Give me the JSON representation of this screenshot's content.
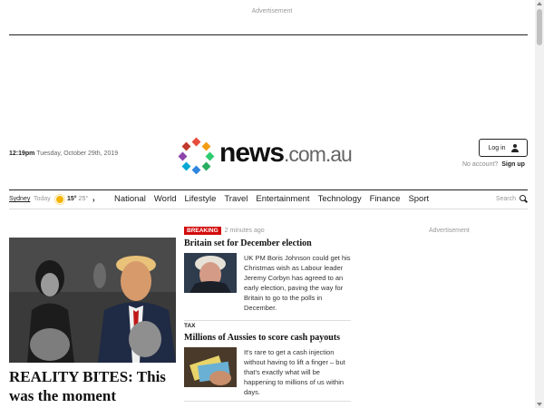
{
  "ads": {
    "top_label": "Advertisement",
    "right_label": "Advertisement"
  },
  "header": {
    "time": "12:19pm",
    "date": "Tuesday, October 29th, 2019",
    "logo_main": "news",
    "logo_domain": ".com.au",
    "login_label": "Log in",
    "no_account_text": "No account?",
    "signup_label": "Sign up"
  },
  "weather": {
    "location": "Sydney",
    "day": "Today",
    "high": "15°",
    "low": "25°",
    "icon": "sun-icon"
  },
  "nav": {
    "items": [
      "National",
      "World",
      "Lifestyle",
      "Travel",
      "Entertainment",
      "Technology",
      "Finance",
      "Sport"
    ],
    "search_label": "Search"
  },
  "hero": {
    "title": "REALITY BITES: This was the moment"
  },
  "stories": [
    {
      "badge": "BREAKING",
      "time_ago": "2 minutes ago",
      "title": "Britain set for December election",
      "text": "UK PM Boris Johnson could get his Christmas wish as Labour leader Jeremy Corbyn has agreed to an early election, paving the way for Britain to go to the polls in December."
    },
    {
      "tag": "TAX",
      "title": "Millions of Aussies to score cash payouts",
      "text": "It's rare to get a cash injection without having to lift a finger – but that's exactly what will be happening to millions of us within days."
    }
  ],
  "colors": {
    "breaking": "#d30b0b",
    "accent_sun": "#f5b400"
  }
}
